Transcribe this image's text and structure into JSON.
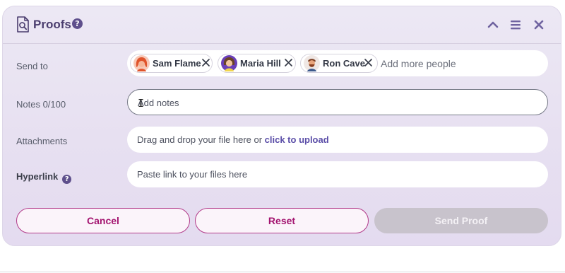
{
  "header": {
    "title": "Proofs",
    "help": "?"
  },
  "send_to": {
    "label": "Send to",
    "recipients": [
      {
        "name": "Sam Flame"
      },
      {
        "name": "Maria Hill"
      },
      {
        "name": "Ron Cave"
      }
    ],
    "placeholder": "Add more people"
  },
  "notes": {
    "label": "Notes 0/100",
    "placeholder": "Add notes"
  },
  "attachments": {
    "label": "Attachments",
    "prompt": "Drag and drop your file here or ",
    "link": "click to upload"
  },
  "hyperlink": {
    "label": "Hyperlink",
    "help": "?",
    "placeholder": "Paste link to your files here"
  },
  "actions": {
    "cancel": "Cancel",
    "reset": "Reset",
    "send": "Send Proof"
  },
  "colors": {
    "accent": "#a3136f",
    "primary": "#5e4f8c",
    "disabled": "#c8c3cc"
  }
}
